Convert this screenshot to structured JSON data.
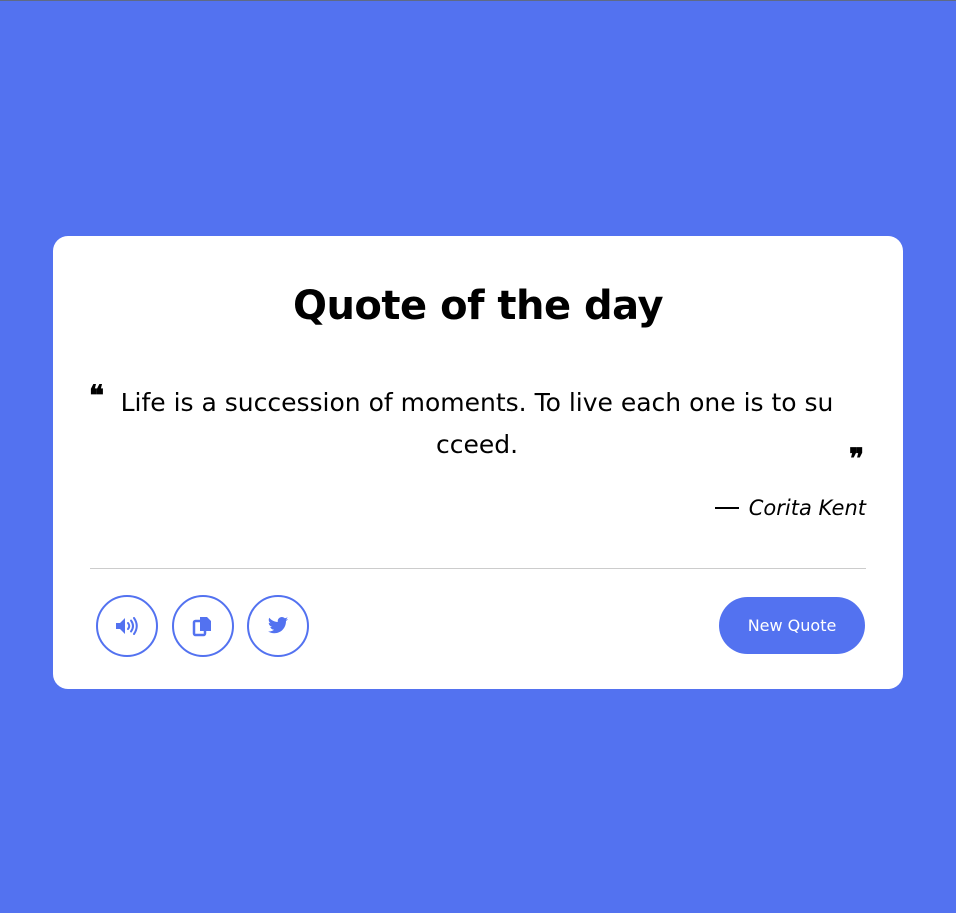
{
  "card": {
    "title": "Quote of the day",
    "quote": {
      "open_mark": "❝",
      "text": "Life is a succession of moments. To live each one is to succeed.",
      "close_mark": "❞"
    },
    "author": {
      "name": "Corita Kent"
    },
    "actions": {
      "speak_icon": "volume-icon",
      "copy_icon": "copy-icon",
      "twitter_icon": "twitter-icon",
      "new_quote_label": "New Quote"
    }
  },
  "colors": {
    "background": "#5372f0",
    "accent": "#5372f0",
    "card": "#ffffff",
    "divider": "#cccccc"
  }
}
